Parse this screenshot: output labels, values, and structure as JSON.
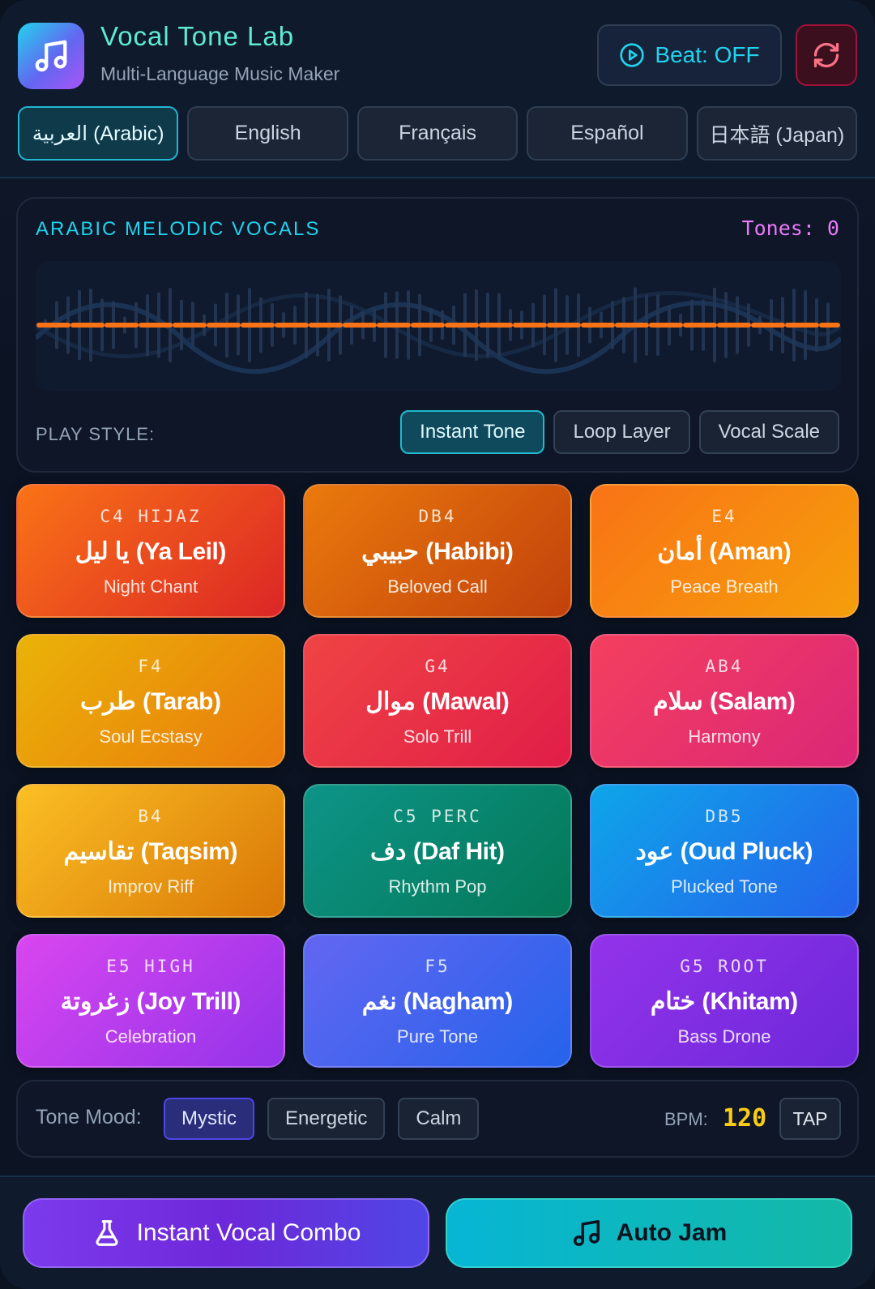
{
  "header": {
    "title": "Vocal Tone Lab",
    "subtitle": "Multi-Language Music Maker",
    "beat_label": "Beat: OFF",
    "logo_icon": "music-note-icon",
    "reset_icon": "refresh-icon"
  },
  "languages": [
    {
      "label": "العربية (Arabic)",
      "active": true
    },
    {
      "label": "English",
      "active": false
    },
    {
      "label": "Français",
      "active": false
    },
    {
      "label": "Español",
      "active": false
    },
    {
      "label": "日本語 (Japan)",
      "active": false
    }
  ],
  "visualizer": {
    "title": "ARABIC MELODIC VOCALS",
    "tones": "Tones: 0"
  },
  "play_style": {
    "label": "PLAY STYLE:",
    "options": [
      {
        "label": "Instant Tone",
        "active": true
      },
      {
        "label": "Loop Layer",
        "active": false
      },
      {
        "label": "Vocal Scale",
        "active": false
      }
    ]
  },
  "pads": [
    {
      "note": "C4 HIJAZ",
      "name": "يا ليل (Ya Leil)",
      "sub": "Night Chant",
      "c1": "#f97316",
      "c2": "#dc2626"
    },
    {
      "note": "DB4",
      "name": "حبيبي (Habibi)",
      "sub": "Beloved Call",
      "c1": "#ea7a0c",
      "c2": "#c2410c"
    },
    {
      "note": "E4",
      "name": "أمان (Aman)",
      "sub": "Peace Breath",
      "c1": "#f97316",
      "c2": "#f59e0b"
    },
    {
      "note": "F4",
      "name": "طرب (Tarab)",
      "sub": "Soul Ecstasy",
      "c1": "#eab308",
      "c2": "#ea7a0c"
    },
    {
      "note": "G4",
      "name": "موال (Mawal)",
      "sub": "Solo Trill",
      "c1": "#ef4444",
      "c2": "#e11d48"
    },
    {
      "note": "AB4",
      "name": "سلام (Salam)",
      "sub": "Harmony",
      "c1": "#f43f5e",
      "c2": "#db2777"
    },
    {
      "note": "B4",
      "name": "تقاسيم (Taqsim)",
      "sub": "Improv Riff",
      "c1": "#fbbf24",
      "c2": "#d97706"
    },
    {
      "note": "C5 PERC",
      "name": "دف (Daf Hit)",
      "sub": "Rhythm Pop",
      "c1": "#0d9488",
      "c2": "#047857"
    },
    {
      "note": "DB5",
      "name": "عود (Oud Pluck)",
      "sub": "Plucked Tone",
      "c1": "#0ea5e9",
      "c2": "#2563eb"
    },
    {
      "note": "E5 HIGH",
      "name": "زغروتة (Joy Trill)",
      "sub": "Celebration",
      "c1": "#d946ef",
      "c2": "#9333ea"
    },
    {
      "note": "F5",
      "name": "نغم (Nagham)",
      "sub": "Pure Tone",
      "c1": "#6366f1",
      "c2": "#2563eb"
    },
    {
      "note": "G5 ROOT",
      "name": "ختام (Khitam)",
      "sub": "Bass Drone",
      "c1": "#9333ea",
      "c2": "#6d28d9"
    }
  ],
  "mood": {
    "label": "Tone Mood:",
    "options": [
      {
        "label": "Mystic",
        "active": true
      },
      {
        "label": "Energetic",
        "active": false
      },
      {
        "label": "Calm",
        "active": false
      }
    ],
    "bpm_label": "BPM:",
    "bpm_value": "120",
    "tap_label": "TAP"
  },
  "footer": {
    "combo_label": "Instant Vocal Combo",
    "combo_icon": "flask-icon",
    "jam_label": "Auto Jam",
    "jam_icon": "music-note-icon"
  }
}
